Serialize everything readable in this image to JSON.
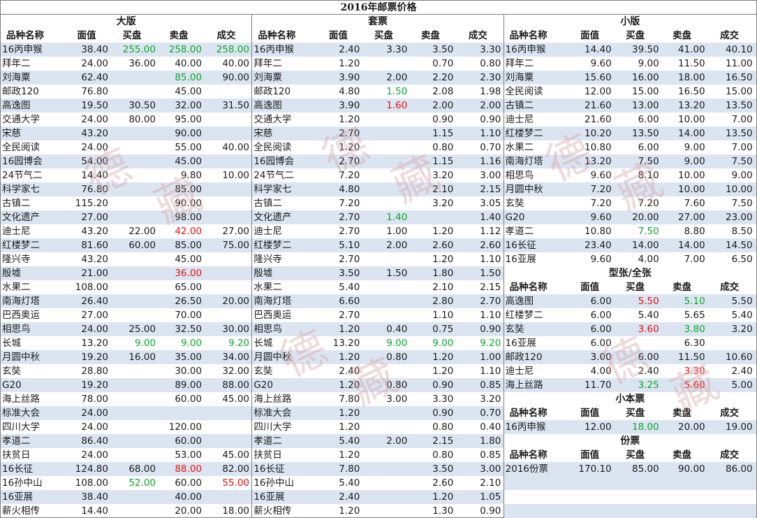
{
  "title": "2016年邮票价格",
  "watermark": "德藏",
  "header": [
    "品种名称",
    "面值",
    "买盘",
    "卖盘",
    "成交"
  ],
  "left": {
    "title": "大版",
    "rows": [
      [
        "16丙申猴",
        "38.40",
        "255.00",
        "258.00",
        "258.00",
        "g",
        "g",
        "g"
      ],
      [
        "拜年二",
        "24.00",
        "36.00",
        "40.00",
        "40.00"
      ],
      [
        "刘海粟",
        "62.40",
        "",
        "85.00",
        "90.00",
        "",
        "g",
        ""
      ],
      [
        "邮政120",
        "76.80",
        "",
        "45.00",
        ""
      ],
      [
        "高逸图",
        "19.50",
        "30.50",
        "32.00",
        "31.50"
      ],
      [
        "交通大学",
        "24.00",
        "80.00",
        "95.00",
        ""
      ],
      [
        "宋慈",
        "43.20",
        "",
        "90.00",
        ""
      ],
      [
        "全民阅读",
        "24.00",
        "",
        "55.00",
        "40.00"
      ],
      [
        "16园博会",
        "54.00",
        "",
        "45.00",
        ""
      ],
      [
        "24节气二",
        "14.40",
        "",
        "9.80",
        "10.00"
      ],
      [
        "科学家七",
        "76.80",
        "",
        "85.00",
        ""
      ],
      [
        "古镇二",
        "115.20",
        "",
        "90.00",
        ""
      ],
      [
        "文化遗产",
        "27.00",
        "",
        "98.00",
        ""
      ],
      [
        "迪士尼",
        "43.20",
        "22.00",
        "42.00",
        "27.00",
        "",
        "r",
        ""
      ],
      [
        "红楼梦二",
        "81.60",
        "60.00",
        "85.00",
        "75.00"
      ],
      [
        "隆兴寺",
        "43.20",
        "",
        "45.00",
        ""
      ],
      [
        "殷墟",
        "21.00",
        "",
        "36.00",
        "",
        "",
        "r",
        ""
      ],
      [
        "水果二",
        "108.00",
        "",
        "65.00",
        ""
      ],
      [
        "南海灯塔",
        "26.40",
        "",
        "26.50",
        "20.00"
      ],
      [
        "巴西奥运",
        "27.00",
        "",
        "70.00",
        ""
      ],
      [
        "相思鸟",
        "24.00",
        "25.00",
        "32.50",
        "30.00"
      ],
      [
        "长城",
        "13.20",
        "9.00",
        "9.00",
        "9.20",
        "g",
        "g",
        "g"
      ],
      [
        "月圆中秋",
        "19.20",
        "16.00",
        "35.00",
        "34.00"
      ],
      [
        "玄奘",
        "28.80",
        "",
        "30.00",
        "32.00"
      ],
      [
        "G20",
        "19.20",
        "",
        "89.00",
        "88.00"
      ],
      [
        "海上丝路",
        "78.00",
        "",
        "60.00",
        "45.00"
      ],
      [
        "标准大会",
        "24.00",
        "",
        "",
        ""
      ],
      [
        "四川大学",
        "24.00",
        "",
        "120.00",
        ""
      ],
      [
        "孝道二",
        "86.40",
        "",
        "60.00",
        ""
      ],
      [
        "扶贫日",
        "24.00",
        "",
        "53.00",
        "45.00"
      ],
      [
        "16长征",
        "124.80",
        "68.00",
        "88.00",
        "82.00",
        "",
        "r",
        ""
      ],
      [
        "16孙中山",
        "108.00",
        "52.00",
        "60.00",
        "55.00",
        "g",
        "",
        "r"
      ],
      [
        "16亚展",
        "38.40",
        "",
        "40.00",
        ""
      ],
      [
        "薪火相传",
        "14.40",
        "",
        "20.00",
        "18.00"
      ]
    ]
  },
  "middle": {
    "title": "套票",
    "rows": [
      [
        "16丙申猴",
        "2.40",
        "3.30",
        "3.50",
        "3.30"
      ],
      [
        "拜年二",
        "1.20",
        "",
        "0.70",
        "0.80"
      ],
      [
        "刘海粟",
        "3.90",
        "2.00",
        "2.20",
        "2.30"
      ],
      [
        "邮政120",
        "4.80",
        "1.50",
        "2.08",
        "1.98",
        "g",
        "",
        ""
      ],
      [
        "高逸图",
        "3.90",
        "1.60",
        "2.00",
        "2.00",
        "r",
        "",
        ""
      ],
      [
        "交通大学",
        "1.20",
        "",
        "0.90",
        "0.90"
      ],
      [
        "宋慈",
        "2.70",
        "",
        "1.15",
        "1.10"
      ],
      [
        "全民阅读",
        "1.20",
        "",
        "0.80",
        "0.70"
      ],
      [
        "16园博会",
        "2.70",
        "",
        "1.15",
        "1.16"
      ],
      [
        "24节气二",
        "7.20",
        "",
        "3.20",
        "3.00"
      ],
      [
        "科学家七",
        "4.80",
        "",
        "2.10",
        "2.15"
      ],
      [
        "古镇二",
        "7.20",
        "",
        "3.20",
        "3.05"
      ],
      [
        "文化遗产",
        "2.70",
        "1.40",
        "",
        "1.40",
        "g",
        "",
        ""
      ],
      [
        "迪士尼",
        "2.70",
        "1.00",
        "1.20",
        "1.12"
      ],
      [
        "红楼梦二",
        "5.10",
        "2.00",
        "2.60",
        "2.60"
      ],
      [
        "隆兴寺",
        "2.70",
        "",
        "1.20",
        "1.10"
      ],
      [
        "殷墟",
        "3.50",
        "1.50",
        "1.80",
        "1.50"
      ],
      [
        "水果二",
        "5.40",
        "",
        "2.10",
        "2.15"
      ],
      [
        "南海灯塔",
        "6.60",
        "",
        "2.80",
        "2.70"
      ],
      [
        "巴西奥运",
        "2.70",
        "",
        "1.10",
        "1.10"
      ],
      [
        "相思鸟",
        "1.20",
        "0.40",
        "0.75",
        "0.90"
      ],
      [
        "长城",
        "13.20",
        "9.00",
        "9.00",
        "9.20",
        "g",
        "g",
        "g"
      ],
      [
        "月圆中秋",
        "1.20",
        "0.80",
        "1.20",
        "1.00"
      ],
      [
        "玄奘",
        "2.40",
        "",
        "1.20",
        "1.10"
      ],
      [
        "G20",
        "1.20",
        "0.80",
        "0.90",
        "0.85"
      ],
      [
        "海上丝路",
        "7.80",
        "3.00",
        "3.30",
        "3.20"
      ],
      [
        "标准大会",
        "1.20",
        "",
        "0.90",
        "0.70"
      ],
      [
        "四川大学",
        "1.20",
        "",
        "0.80",
        "0.40"
      ],
      [
        "孝道二",
        "5.40",
        "2.00",
        "2.15",
        "1.80"
      ],
      [
        "扶贫日",
        "1.20",
        "",
        "0.80",
        "0.85"
      ],
      [
        "16长征",
        "7.80",
        "",
        "3.50",
        "3.00"
      ],
      [
        "16孙中山",
        "5.40",
        "",
        "2.60",
        "2.10"
      ],
      [
        "16亚展",
        "2.40",
        "",
        "1.20",
        "1.05"
      ],
      [
        "薪火相传",
        "1.20",
        "",
        "1.30",
        "0.90"
      ]
    ]
  },
  "right": {
    "small": {
      "title": "小版",
      "rows": [
        [
          "16丙申猴",
          "14.40",
          "39.50",
          "41.00",
          "40.10"
        ],
        [
          "拜年二",
          "9.60",
          "9.00",
          "11.50",
          "11.00"
        ],
        [
          "刘海粟",
          "15.60",
          "16.00",
          "18.00",
          "16.50"
        ],
        [
          "全民阅读",
          "12.00",
          "15.00",
          "16.50",
          "15.00"
        ],
        [
          "古镇二",
          "21.60",
          "13.00",
          "13.20",
          "13.50"
        ],
        [
          "迪士尼",
          "21.60",
          "6.00",
          "10.00",
          "7.00"
        ],
        [
          "红楼梦二",
          "10.20",
          "13.50",
          "14.00",
          "13.50"
        ],
        [
          "水果二",
          "10.80",
          "6.00",
          "9.00",
          "7.00"
        ],
        [
          "南海灯塔",
          "13.20",
          "7.50",
          "9.00",
          "7.50"
        ],
        [
          "相思鸟",
          "9.60",
          "8.10",
          "10.00",
          "9.00"
        ],
        [
          "月圆中秋",
          "7.20",
          "",
          "10.00",
          "10.00"
        ],
        [
          "玄奘",
          "7.20",
          "7.20",
          "7.60",
          "7.50"
        ],
        [
          "G20",
          "9.60",
          "20.00",
          "27.00",
          "23.00"
        ],
        [
          "孝道二",
          "10.80",
          "7.50",
          "8.80",
          "8.50",
          "g",
          "",
          ""
        ],
        [
          "16长征",
          "23.40",
          "14.00",
          "14.00",
          "14.50"
        ],
        [
          "16亚展",
          "9.60",
          "4.00",
          "7.00",
          "6.50"
        ]
      ]
    },
    "type": {
      "title": "型张/全张",
      "rows": [
        [
          "高逸图",
          "6.00",
          "5.50",
          "5.10",
          "5.50",
          "r",
          "g",
          ""
        ],
        [
          "红楼梦二",
          "6.00",
          "5.40",
          "5.65",
          "5.40"
        ],
        [
          "玄奘",
          "6.00",
          "3.60",
          "3.80",
          "3.20",
          "r",
          "g",
          ""
        ],
        [
          "16亚展",
          "6.00",
          "",
          "6.30",
          ""
        ],
        [
          "邮政120",
          "3.00",
          "6.00",
          "11.50",
          "10.60"
        ],
        [
          "迪士尼",
          "4.00",
          "2.40",
          "3.30",
          "2.40",
          "",
          "r",
          ""
        ],
        [
          "海上丝路",
          "11.70",
          "3.25",
          "5.60",
          "5.00",
          "g",
          "r",
          ""
        ]
      ]
    },
    "booklet": {
      "title": "小本票",
      "rows": [
        [
          "16丙申猴",
          "12.00",
          "18.00",
          "20.00",
          "19.00",
          "g",
          "",
          ""
        ]
      ]
    },
    "annual": {
      "title": "份票",
      "rows": [
        [
          "2016份票",
          "170.10",
          "85.00",
          "90.00",
          "86.00"
        ]
      ]
    }
  }
}
